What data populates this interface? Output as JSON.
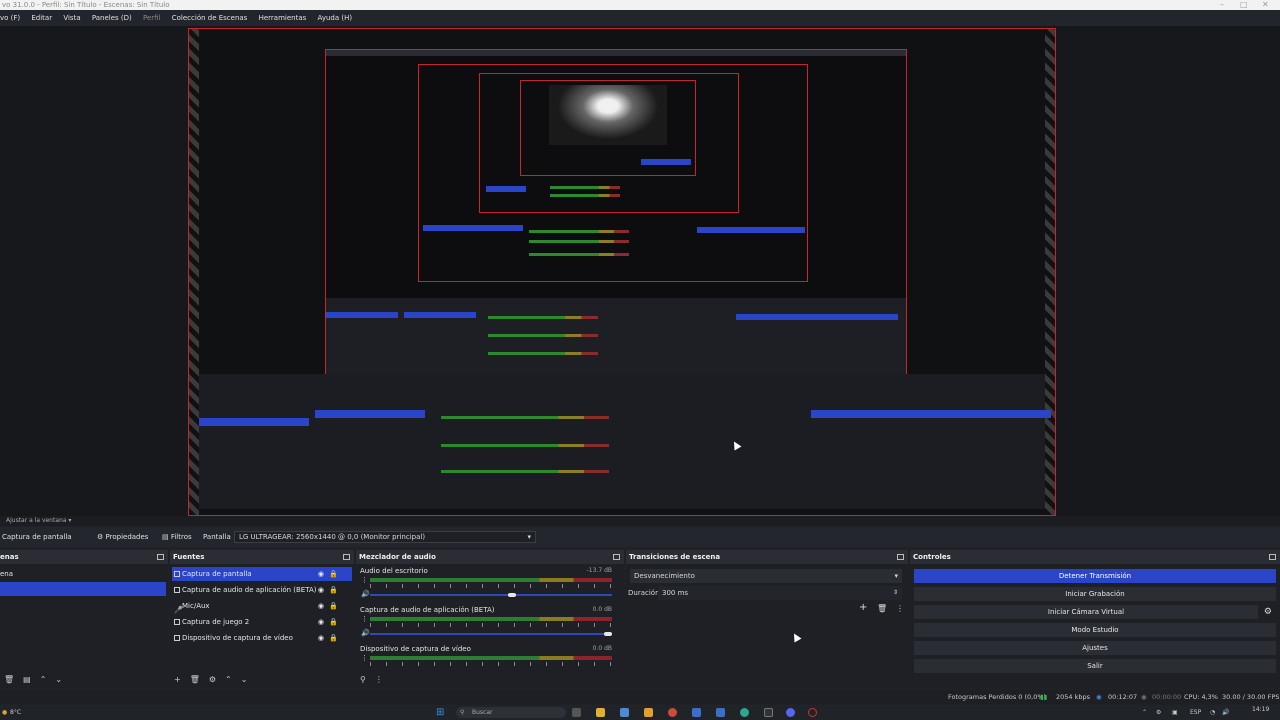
{
  "titlebar": {
    "title": "vo 31.0.0 - Perfil: Sin Título - Escenas: Sin Título"
  },
  "menu": [
    {
      "label": "vo (F)"
    },
    {
      "label": "Editar"
    },
    {
      "label": "Vista"
    },
    {
      "label": "Paneles (D)"
    },
    {
      "label": "Perfil",
      "dim": true
    },
    {
      "label": "Colección de Escenas"
    },
    {
      "label": "Herramientas"
    },
    {
      "label": "Ayuda (H)"
    }
  ],
  "statusline": {
    "text": "Ajustar a la ventana"
  },
  "toolbar": {
    "source_name": "Captura de pantalla",
    "properties": "Propiedades",
    "filters": "Filtros",
    "display_label": "Pantalla",
    "display_value": "LG ULTRAGEAR: 2560x1440 @ 0,0 (Monitor principal)"
  },
  "scenes": {
    "title": "enas",
    "items": [
      "ena"
    ]
  },
  "sources": {
    "title": "Fuentes",
    "items": [
      {
        "label": "Captura de pantalla",
        "icon": "monitor-icon",
        "selected": true
      },
      {
        "label": "Captura de audio de aplicación (BETA)",
        "icon": "window-icon",
        "selected": false
      },
      {
        "label": "Mic/Aux",
        "icon": "mic-icon",
        "selected": false
      },
      {
        "label": "Captura de juego 2",
        "icon": "gamepad-icon",
        "selected": false
      },
      {
        "label": "Dispositivo de captura de vídeo",
        "icon": "camera-icon",
        "selected": false
      }
    ]
  },
  "mixer": {
    "title": "Mezclador de audio",
    "channels": [
      {
        "name": "Audio del escritorio",
        "db": "-13.7 dB",
        "volume": 0.88
      },
      {
        "name": "Captura de audio de aplicación (BETA)",
        "db": "0.0 dB",
        "volume": 1.0
      },
      {
        "name": "Dispositivo de captura de vídeo",
        "db": "0.0 dB",
        "volume": 1.0
      }
    ]
  },
  "transitions": {
    "title": "Transiciones de escena",
    "type": "Desvanecimiento",
    "duration_label": "Duración",
    "duration_value": "300 ms"
  },
  "controls": {
    "title": "Controles",
    "buttons": [
      "Detener Transmisión",
      "Iniciar Grabación",
      "Iniciar Cámara Virtual",
      "Modo Estudio",
      "Ajustes",
      "Salir"
    ]
  },
  "stats": {
    "dropped": "Fotogramas Perdidos 0 (0,0%)",
    "bitrate": "2054 kbps",
    "stream_time": "00:12:07",
    "rec_time": "00:00:00",
    "cpu": "CPU: 4,3%",
    "fps": "30.00 / 30.00 FPS"
  },
  "taskbar": {
    "weather": "8°C",
    "search_placeholder": "Buscar",
    "lang": "ESP",
    "time": "14:19"
  },
  "colors": {
    "accent": "#2b45c8",
    "preview_border": "#c8252b",
    "bg": "#1e2026"
  }
}
